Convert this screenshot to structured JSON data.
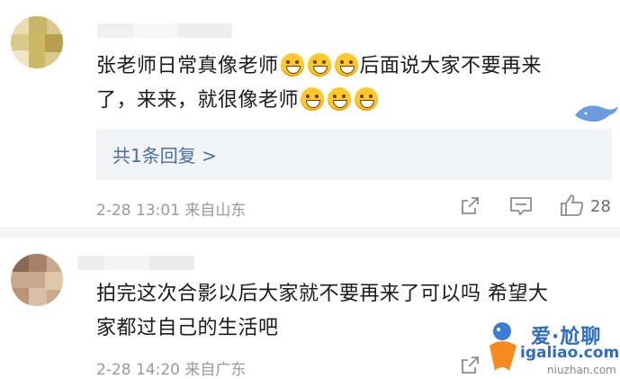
{
  "comments": [
    {
      "text": "张老师日常真像老师",
      "text_mid": "后面说大家不要再来",
      "text_line2": "了，来来，就很像老师",
      "reply_link": "共1条回复 >",
      "date": "2-28",
      "time": "13:01",
      "location": "来自山东",
      "likes": "28"
    },
    {
      "text": "拍完这次合影以后大家就不要再来了可以吗 希望大",
      "text_line2": "家都过自己的生活吧",
      "date": "2-28",
      "time": "14:20",
      "location": "来自广东"
    }
  ],
  "watermark": {
    "brand": "爱·尬聊",
    "url": "igaliao.com",
    "sub": "niuzhan.com"
  },
  "colors": {
    "link": "#4a6da8",
    "meta": "#9a9a9a",
    "reply_bg": "#f3f4f7"
  }
}
